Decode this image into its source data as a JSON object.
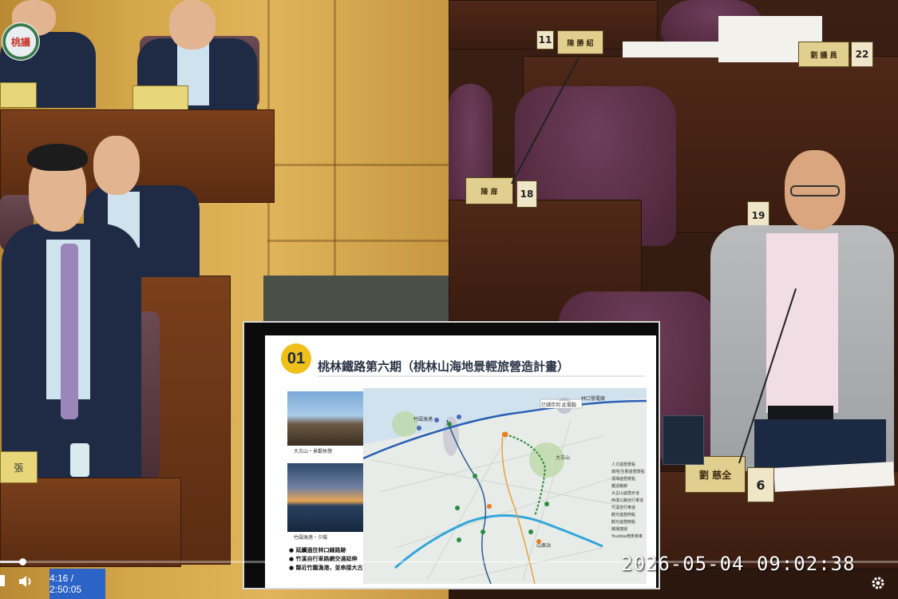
{
  "logo": {
    "text": "桃議"
  },
  "nameplates": {
    "left_bottom": "張",
    "seat_18_name": "陳 扉",
    "seat_18_num": "18",
    "seat_19_num": "19",
    "seat_6_name": "劉 慈全",
    "seat_6_num": "6",
    "seat_11_num": "11",
    "seat_11_name": "陳 勝 紹",
    "seat_22_num": "22",
    "seat_22_name": "劉 議 員"
  },
  "slide": {
    "number": "01",
    "title": "桃林鐵路第六期（桃林山海地景輕旅營造計畫）",
    "photo1_caption": "大古山・景觀休憩",
    "photo2_caption": "竹圍漁港・夕陽",
    "bullets": [
      "延續過往林口線路跡",
      "竹溪自行車路網交通延伸",
      "鄰近竹圍漁港，並串接大古山遊憩帶"
    ],
    "map_labels": {
      "linkou": "林口發電廠",
      "note": "已儲存到 此電腦",
      "station": "山鼻站",
      "port": "竹圍漁港",
      "park": "大古山"
    },
    "legend": [
      "人文遊憩景點",
      "綠地/生態遊憩景點",
      "濱海遊憩景點",
      "鐵道路廊",
      "大古山遊憩步道",
      "西濱公路自行車道",
      "竹溪自行車道",
      "觀光遊憩熱點",
      "觀光遊憩節點",
      "機場捷運",
      "Youbike微笑單車"
    ]
  },
  "video": {
    "time": "4:16 / 2:50:05",
    "timestamp": "2026-05-04  09:02:38",
    "progress": 0.025,
    "icons": [
      "play-icon",
      "volume-icon",
      "settings-icon"
    ]
  }
}
